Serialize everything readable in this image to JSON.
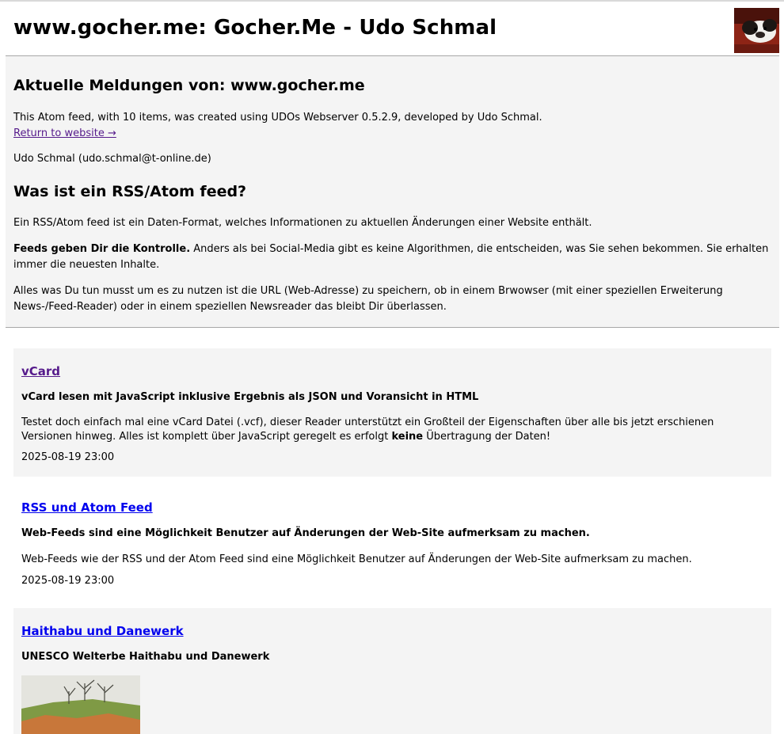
{
  "header": {
    "site_title": "www.gocher.me: Gocher.Me - Udo Schmal"
  },
  "info": {
    "heading": "Aktuelle Meldungen von: www.gocher.me",
    "feed_description": "This Atom feed, with 10 items, was created using UDOs Webserver 0.5.2.9, developed by Udo Schmal.",
    "return_link": "Return to website →",
    "author": "Udo Schmal (udo.schmal@t-online.de)",
    "what_heading": "Was ist ein RSS/Atom feed?",
    "what_p1": "Ein RSS/Atom feed ist ein Daten-Format, welches Informationen zu aktuellen Änderungen einer Website enthält.",
    "what_p2_bold": "Feeds geben Dir die Kontrolle.",
    "what_p2_rest": " Anders als bei Social-Media gibt es keine Algorithmen, die entscheiden, was Sie sehen bekommen. Sie erhalten immer die neuesten Inhalte.",
    "what_p3": "Alles was Du tun musst um es zu nutzen ist die URL (Web-Adresse) zu speichern, ob in einem Brwowser (mit einer speziellen Erweiterung News-/Feed-Reader) oder in einem speziellen Newsreader das bleibt Dir überlassen."
  },
  "items": [
    {
      "title": "vCard",
      "subtitle": "vCard lesen mit JavaScript inklusive Ergebnis als JSON und Voransicht in HTML",
      "body_before": "Testet doch einfach mal eine vCard Datei (.vcf), dieser Reader unterstützt ein Großteil der Eigenschaften über alle bis jetzt erschienen Versionen hinweg. Alles ist komplett über JavaScript geregelt es erfolgt ",
      "body_bold": "keine",
      "body_after": " Übertragung der Daten!",
      "date": "2025-08-19 23:00"
    },
    {
      "title": "RSS und Atom Feed",
      "subtitle": "Web-Feeds sind eine Möglichkeit Benutzer auf Änderungen der Web-Site aufmerksam zu machen.",
      "body": "Web-Feeds wie der RSS und der Atom Feed sind eine Möglichkeit Benutzer auf Änderungen der Web-Site aufmerksam zu machen.",
      "date": "2025-08-19 23:00"
    },
    {
      "title": "Haithabu und Danewerk",
      "subtitle": "UNESCO Welterbe Haithabu und Danewerk"
    }
  ],
  "colors": {
    "panel_bg": "#f4f4f4",
    "visited_link": "#551a8b",
    "link": "#0000ee",
    "divider": "#a8a8a8"
  },
  "icons": {
    "avatar": "dog-photo-avatar",
    "thumbnail": "landscape-photo-thumbnail"
  }
}
